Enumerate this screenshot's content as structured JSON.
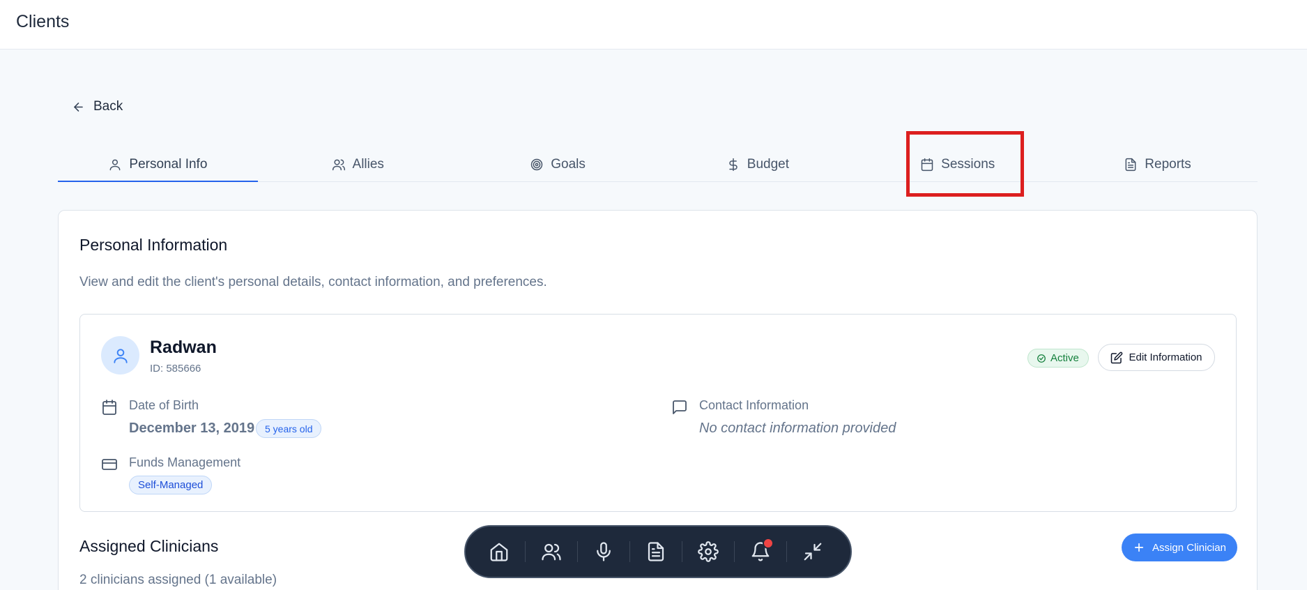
{
  "header": {
    "title": "Clients"
  },
  "nav": {
    "back_label": "Back"
  },
  "tabs": [
    {
      "label": "Personal Info",
      "icon": "user-icon",
      "active": true
    },
    {
      "label": "Allies",
      "icon": "users-icon",
      "active": false
    },
    {
      "label": "Goals",
      "icon": "target-icon",
      "active": false
    },
    {
      "label": "Budget",
      "icon": "dollar-icon",
      "active": false
    },
    {
      "label": "Sessions",
      "icon": "calendar-icon",
      "active": false,
      "highlighted": true
    },
    {
      "label": "Reports",
      "icon": "document-icon",
      "active": false
    }
  ],
  "panel": {
    "title": "Personal Information",
    "description": "View and edit the client's personal details, contact information, and preferences."
  },
  "client": {
    "name": "Radwan",
    "id_text": "ID: 585666",
    "status": "Active",
    "edit_label": "Edit Information",
    "dob_label": "Date of Birth",
    "dob_value": "December 13, 2019",
    "age_badge": "5 years old",
    "contact_label": "Contact Information",
    "contact_value": "No contact information provided",
    "funds_label": "Funds Management",
    "funds_value": "Self-Managed"
  },
  "clinicians": {
    "title": "Assigned Clinicians",
    "subtitle": "2 clinicians assigned (1 available)",
    "assign_label": "Assign Clinician"
  },
  "dock": {
    "items": [
      "home-icon",
      "users-icon",
      "microphone-icon",
      "document-icon",
      "gear-icon",
      "bell-icon",
      "minimize-icon"
    ],
    "notification": true
  },
  "colors": {
    "accent": "#2563eb",
    "highlight": "#dc1f1f",
    "status_green": "#15803d",
    "dock_bg": "#1e293b"
  }
}
